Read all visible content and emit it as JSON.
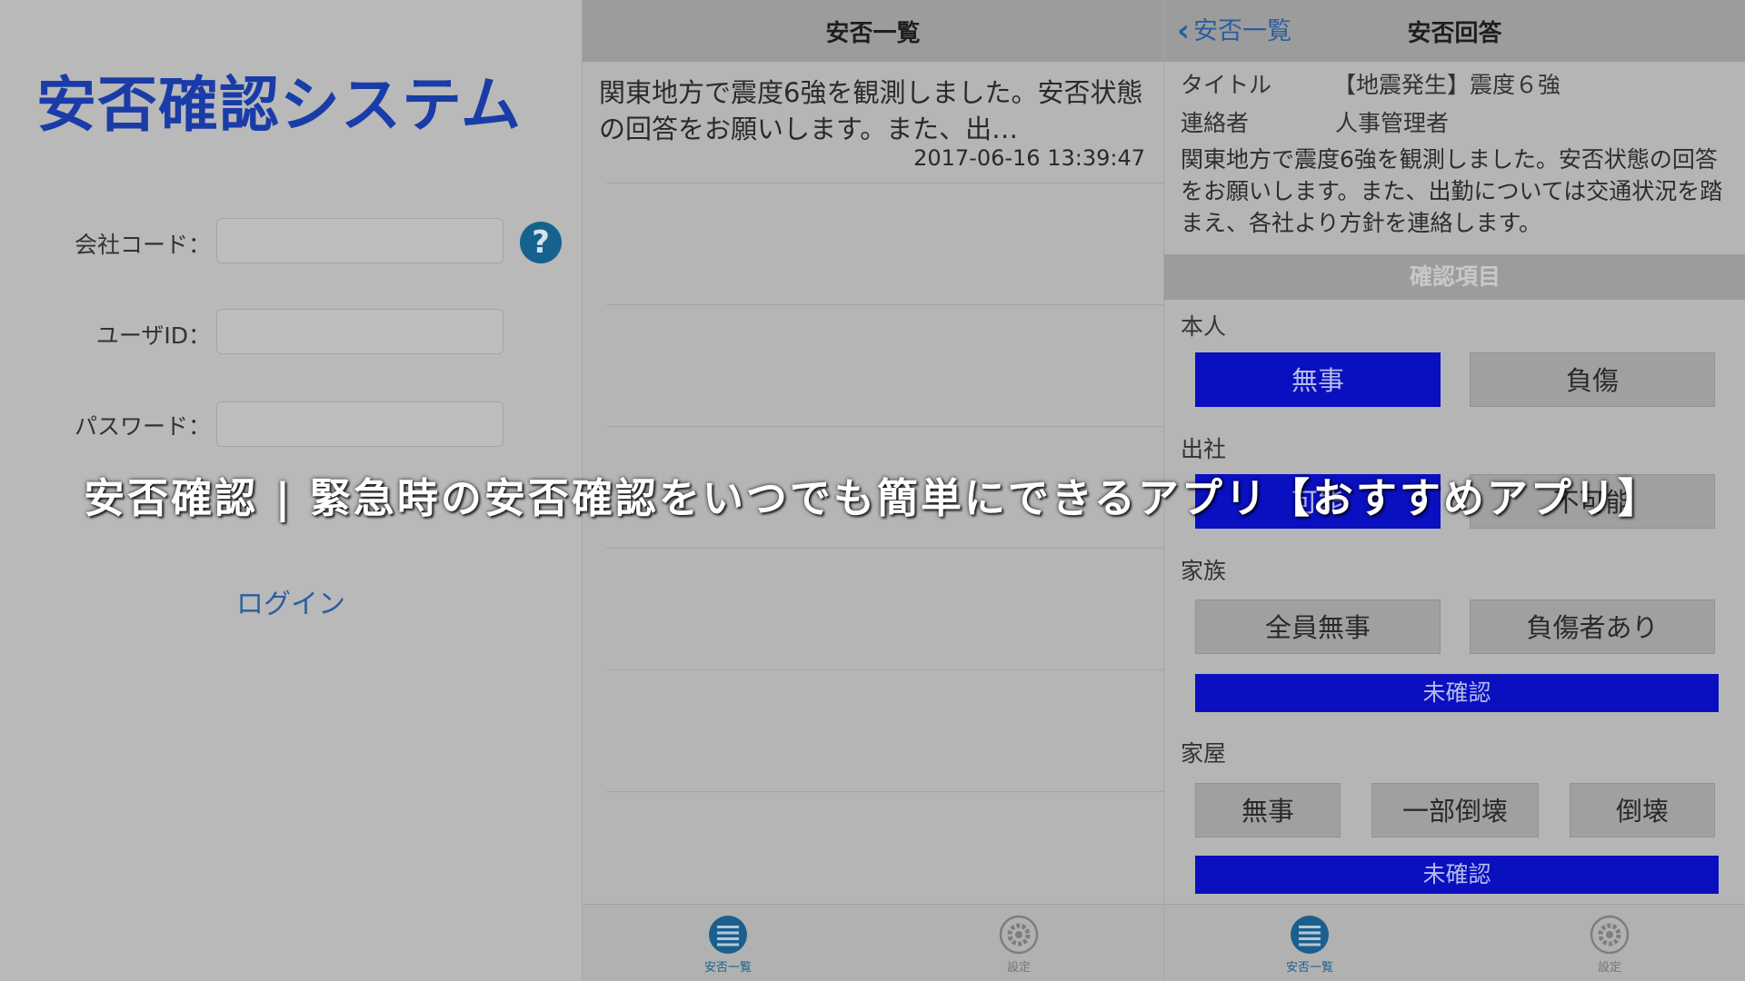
{
  "login": {
    "logo": "安否確認システム",
    "company_code_label": "会社コード：",
    "user_id_label": "ユーザID：",
    "password_label": "パスワード：",
    "company_code_value": "",
    "user_id_value": "",
    "password_value": "",
    "help_glyph": "?",
    "login_label": "ログイン"
  },
  "list": {
    "nav_title": "安否一覧",
    "items": [
      {
        "message": "関東地方で震度6強を観測しました。安否状態の回答をお願いします。また、出…",
        "date": "2017-06-16 13:39:47"
      }
    ],
    "tabs": [
      {
        "label": "安否一覧",
        "icon": "list-icon"
      },
      {
        "label": "設定",
        "icon": "gear-icon"
      }
    ]
  },
  "answer": {
    "back_label": "安否一覧",
    "nav_title": "安否回答",
    "title_key": "タイトル",
    "title_value": "【地震発生】震度６強",
    "contact_key": "連絡者",
    "contact_value": "人事管理者",
    "body": "関東地方で震度6強を観測しました。安否状態の回答をお願いします。また、出勤については交通状況を踏まえ、各社より方針を連絡します。",
    "section_title": "確認項目",
    "groups": {
      "self": {
        "label": "本人",
        "options": [
          "無事",
          "負傷"
        ],
        "selected": "無事"
      },
      "work": {
        "label": "出社",
        "options": [
          "可能",
          "不可能"
        ],
        "selected": "可能"
      },
      "family": {
        "label": "家族",
        "options": [
          "全員無事",
          "負傷者あり"
        ],
        "status": "未確認"
      },
      "house": {
        "label": "家屋",
        "options": [
          "無事",
          "一部倒壊",
          "倒壊"
        ],
        "status": "未確認"
      }
    },
    "tabs": [
      {
        "label": "安否一覧",
        "icon": "list-icon"
      },
      {
        "label": "設定",
        "icon": "gear-icon"
      }
    ]
  },
  "caption": "安否確認 | 緊急時の安否確認をいつでも簡単にできるアプリ【おすすめアプリ】",
  "colors": {
    "accent_blue": "#0a0fc0",
    "logo_blue": "#1a3ca8",
    "link_blue": "#2b5e9e",
    "tab_active": "#1a5f8e"
  }
}
